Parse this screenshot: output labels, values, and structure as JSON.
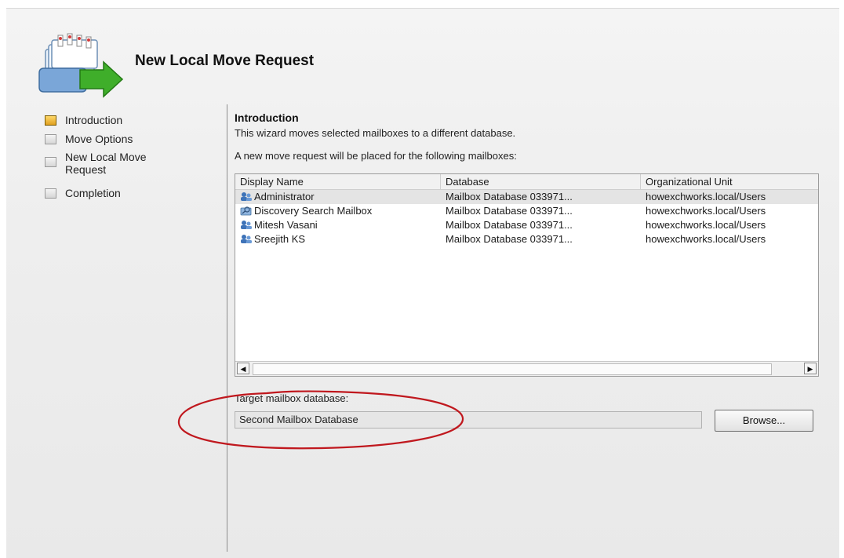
{
  "window": {
    "title": "New Local Move Request"
  },
  "nav": {
    "items": [
      {
        "label": "Introduction",
        "active": true
      },
      {
        "label": "Move Options",
        "active": false
      },
      {
        "label": "New Local Move\nRequest",
        "active": false
      },
      {
        "label": "Completion",
        "active": false
      }
    ]
  },
  "intro": {
    "heading": "Introduction",
    "description": "This wizard moves selected mailboxes to a different database.",
    "list_caption": "A new move request will be placed for the following mailboxes:"
  },
  "grid": {
    "columns": [
      "Display Name",
      "Database",
      "Organizational Unit"
    ],
    "rows": [
      {
        "icon": "user-mailbox-icon",
        "name": "Administrator",
        "database": "Mailbox Database 033971...",
        "ou": "howexchworks.local/Users"
      },
      {
        "icon": "discovery-mailbox-icon",
        "name": "Discovery Search Mailbox",
        "database": "Mailbox Database 033971...",
        "ou": "howexchworks.local/Users"
      },
      {
        "icon": "user-mailbox-icon",
        "name": "Mitesh Vasani",
        "database": "Mailbox Database 033971...",
        "ou": "howexchworks.local/Users"
      },
      {
        "icon": "user-mailbox-icon",
        "name": "Sreejith KS",
        "database": "Mailbox Database 033971...",
        "ou": "howexchworks.local/Users"
      }
    ]
  },
  "target": {
    "label": "Target mailbox database:",
    "value": "Second Mailbox Database",
    "browse_label": "Browse..."
  },
  "colors": {
    "annotation": "#c0181e",
    "active_step": "#e8a820"
  }
}
